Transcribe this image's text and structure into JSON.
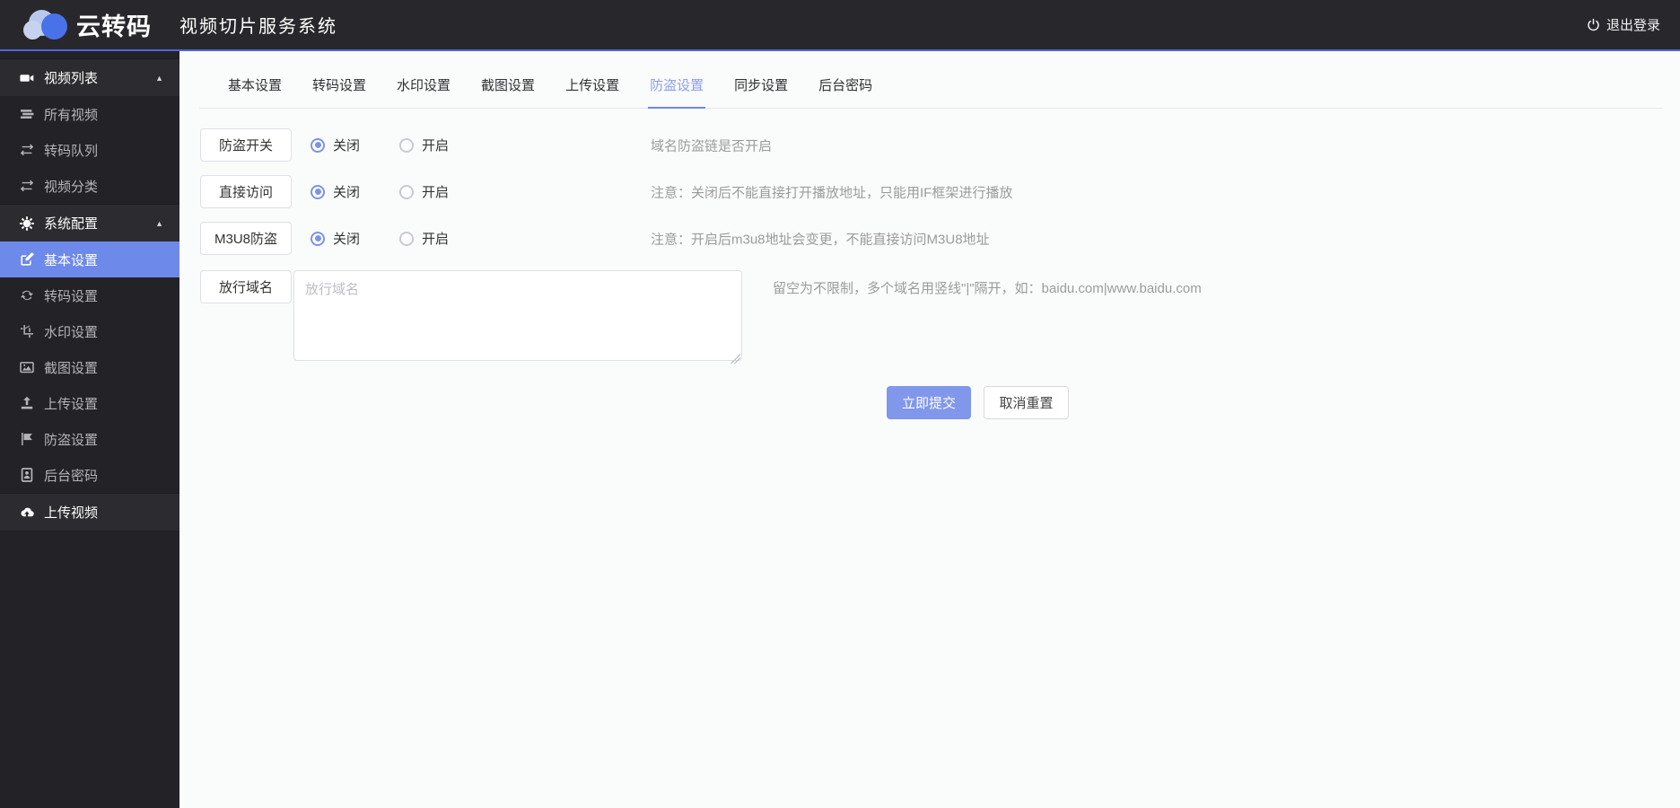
{
  "colors": {
    "accent": "#6d89e9",
    "accent_light": "#8d9eec",
    "header_border": "#4d65da",
    "button_primary": "#8097eb",
    "radio_selected": "#7b93e9"
  },
  "header": {
    "brand": "云转码",
    "title": "视频切片服务系统",
    "logout_label": "退出登录"
  },
  "sidebar": {
    "items": [
      {
        "label": "视频列表",
        "icon": "video-camera-icon",
        "type": "section",
        "expanded": true
      },
      {
        "label": "所有视频",
        "icon": "list-icon",
        "type": "item"
      },
      {
        "label": "转码队列",
        "icon": "exchange-icon",
        "type": "item"
      },
      {
        "label": "视频分类",
        "icon": "exchange-icon",
        "type": "item"
      },
      {
        "label": "系统配置",
        "icon": "gear-icon",
        "type": "section",
        "expanded": true
      },
      {
        "label": "基本设置",
        "icon": "edit-icon",
        "type": "item",
        "active": true
      },
      {
        "label": "转码设置",
        "icon": "sync-icon",
        "type": "item"
      },
      {
        "label": "水印设置",
        "icon": "crop-icon",
        "type": "item"
      },
      {
        "label": "截图设置",
        "icon": "image-icon",
        "type": "item"
      },
      {
        "label": "上传设置",
        "icon": "upload-icon",
        "type": "item"
      },
      {
        "label": "防盗设置",
        "icon": "flag-icon",
        "type": "item"
      },
      {
        "label": "后台密码",
        "icon": "id-card-icon",
        "type": "item"
      },
      {
        "label": "上传视频",
        "icon": "cloud-upload-icon",
        "type": "section"
      }
    ]
  },
  "tabs": {
    "items": [
      {
        "label": "基本设置"
      },
      {
        "label": "转码设置"
      },
      {
        "label": "水印设置"
      },
      {
        "label": "截图设置"
      },
      {
        "label": "上传设置"
      },
      {
        "label": "防盗设置",
        "active": true
      },
      {
        "label": "同步设置"
      },
      {
        "label": "后台密码"
      }
    ]
  },
  "form": {
    "radio_rows": [
      {
        "label": "防盗开关",
        "options": [
          {
            "label": "关闭",
            "selected": true
          },
          {
            "label": "开启",
            "selected": false
          }
        ],
        "hint": "域名防盗链是否开启"
      },
      {
        "label": "直接访问",
        "options": [
          {
            "label": "关闭",
            "selected": true
          },
          {
            "label": "开启",
            "selected": false
          }
        ],
        "hint": "注意：关闭后不能直接打开播放地址，只能用IF框架进行播放"
      },
      {
        "label": "M3U8防盗",
        "options": [
          {
            "label": "关闭",
            "selected": true
          },
          {
            "label": "开启",
            "selected": false
          }
        ],
        "hint": "注意：开启后m3u8地址会变更，不能直接访问M3U8地址"
      }
    ],
    "domain_row": {
      "label": "放行域名",
      "placeholder": "放行域名",
      "value": "",
      "hint": "留空为不限制，多个域名用竖线\"|\"隔开，如：baidu.com|www.baidu.com"
    },
    "submit_label": "立即提交",
    "reset_label": "取消重置"
  }
}
